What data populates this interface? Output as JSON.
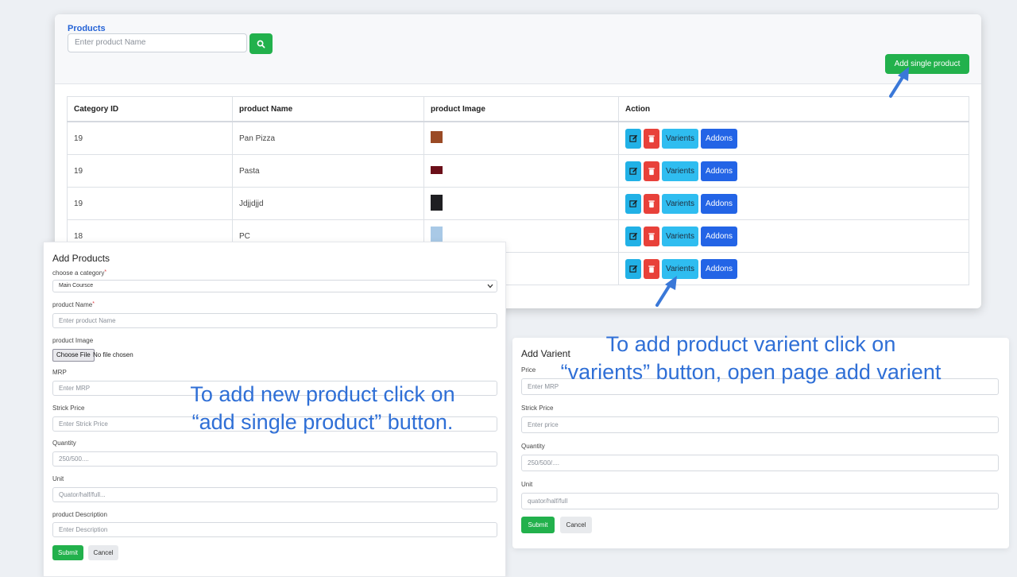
{
  "products_panel": {
    "title": "Products",
    "search_placeholder": "Enter product Name",
    "search_icon": "search-icon",
    "add_button_label": "Add single product",
    "columns": [
      "Category ID",
      "product Name",
      "product Image",
      "Action"
    ],
    "rows": [
      {
        "category_id": "19",
        "name": "Pan Pizza",
        "thumb_color": "#9a4a25"
      },
      {
        "category_id": "19",
        "name": "Pasta",
        "thumb_color": "#6b0f19"
      },
      {
        "category_id": "19",
        "name": "Jdjjdjjd",
        "thumb_color": "#1f1f22"
      },
      {
        "category_id": "18",
        "name": "PC",
        "thumb_color": "#a9c9e6"
      },
      {
        "category_id": "",
        "name": "",
        "thumb_color": "#b3202a"
      }
    ],
    "row_actions": {
      "edit_icon": "edit-icon",
      "delete_icon": "trash-icon",
      "variants_label": "Varients",
      "addons_label": "Addons"
    }
  },
  "add_products_form": {
    "title": "Add Products",
    "category_label": "choose a category",
    "category_value": "Main Coursce",
    "name_label": "product Name",
    "name_placeholder": "Enter product Name",
    "image_label": "product Image",
    "file_button": "Choose File",
    "file_status": "No file chosen",
    "mrp_label": "MRP",
    "mrp_placeholder": "Enter MRP",
    "strick_label": "Strick Price",
    "strick_placeholder": "Enter Strick Price",
    "quantity_label": "Quantity",
    "quantity_placeholder": "250/500....",
    "unit_label": "Unit",
    "unit_placeholder": "Quator/half/full...",
    "description_label": "product Description",
    "description_placeholder": "Enter Description",
    "submit_label": "Submit",
    "cancel_label": "Cancel",
    "required_marker": "*"
  },
  "add_variant_form": {
    "title": "Add Varient",
    "price_label": "Price",
    "price_placeholder": "Enter MRP",
    "strick_label": "Strick Price",
    "strick_placeholder": "Enter price",
    "quantity_label": "Quantity",
    "quantity_placeholder": "250/500/....",
    "unit_label": "Unit",
    "unit_placeholder": "quator/half/full",
    "submit_label": "Submit",
    "cancel_label": "Cancel"
  },
  "annotations": {
    "add_product_line1": "To add new product click on",
    "add_product_line2": "“add single product” button.",
    "variant_line1": "To add product varient click on",
    "variant_line2": "“varients” button, open page add varient"
  },
  "colors": {
    "green": "#22b14c",
    "cyan": "#2fbdf0",
    "blue": "#2364e6",
    "red": "#e8413a",
    "annotation_blue": "#2f6fd6"
  }
}
